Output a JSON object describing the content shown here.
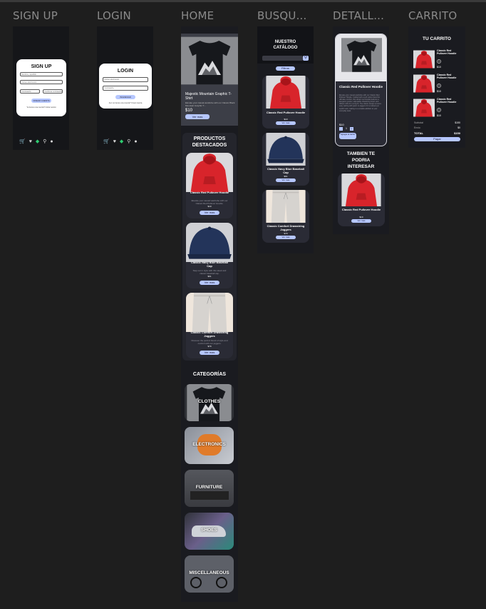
{
  "columns": {
    "signup": "SIGN UP",
    "login": "LOGIN",
    "home": "HOME",
    "busqueda": "BUSQU...",
    "detalle": "DETALL...",
    "carrito": "CARRITO"
  },
  "signup": {
    "title": "SIGN UP",
    "field1": "Nombre y apellido",
    "field2": "Correo electronico",
    "field3": "Contraseña",
    "field4": "Confirmar contraseña",
    "button": "CREAR CUENTA",
    "footer": "Ya tienes una cuenta? Iniciar sesion"
  },
  "login": {
    "title": "LOGIN",
    "field1": "Correo electronico",
    "field2": "Contraseña",
    "button": "INGRESAR",
    "footer": "Aun no tienes una cuenta? Crear cuenta"
  },
  "home": {
    "hero_title": "Majestic Mountain Graphic T-Shirt",
    "hero_desc": "Elevate your casual wardrobe with our Classic Black Mountain Graphic T...",
    "hero_price": "$10",
    "hero_button": "Ver mas",
    "featured_title": "PRODUCTOS DESTACADOS",
    "products": [
      {
        "name": "Classic Red Pullover Hoodie",
        "desc": "Elevate your casual wardrobe with our Classic Red Pullover Hoodie.",
        "price": "$10",
        "button": "Ver mas"
      },
      {
        "name": "Classic Navy Blue Baseball Cap",
        "desc": "Step out in style with this sleek and classic baseball cap.",
        "price": "$61",
        "button": "Ver mas"
      },
      {
        "name": "Classic Comfort Drawstring Joggers",
        "desc": "Discover the perfect blend of style and comfort with our joggers.",
        "price": "$79",
        "button": "Ver mas"
      }
    ],
    "categories_title": "CATEGORÍAS",
    "categories": [
      "CLOTHES",
      "ELECTRONICS",
      "FURNITURE",
      "SHOES",
      "MISCELLANEOUS"
    ]
  },
  "search": {
    "title": "NUESTRO CATÁLOGO",
    "filter_button": "Filtros",
    "products": [
      {
        "name": "Classic Red Pullover Hoodie",
        "price": "$10",
        "button": "Ver mas"
      },
      {
        "name": "Classic Navy Blue Baseball Cap",
        "price": "$61",
        "button": "Ver mas"
      },
      {
        "name": "Classic Comfort Drawstring Joggers",
        "price": "$79",
        "button": "Ver mas"
      }
    ]
  },
  "detail": {
    "name": "Classic Red Pullover Hoodie",
    "desc": "Elevate your casual wardrobe with our Classic Red Pullover Hoodie. Crafted with a soft cotton blend for ultimate comfort, this vibrant red hoodie features a kangaroo pocket, adjustable drawstring hood, and ribbed cuffs for a snug fit. The classic design ensures easy pairing with jeans or joggers for a relaxed yet stylish look, making it a versatile addition to your everyday wear.",
    "price": "$10",
    "qty": "1",
    "add_button": "Agregar al carrito",
    "also_title": "TAMBIEN TE PODRIA INTERESAR",
    "also_name": "Classic Red Pullover Hoodie",
    "also_price": "$10",
    "also_button": "Ver mas"
  },
  "cart": {
    "title": "TU CARRITO",
    "items": [
      {
        "name": "Classic Red Pullover Hoodie",
        "qty": "1",
        "price": "$10"
      },
      {
        "name": "Classic Red Pullover Hoodie",
        "qty": "1",
        "price": "$10"
      },
      {
        "name": "Classic Red Pullover Hoodie",
        "qty": "1",
        "price": "$10"
      }
    ],
    "subtotal_label": "Subtotal",
    "subtotal": "$150",
    "envio_label": "Envio",
    "envio": "$0",
    "total_label": "TOTAL",
    "total": "$150",
    "pay_button": "Pagar"
  }
}
